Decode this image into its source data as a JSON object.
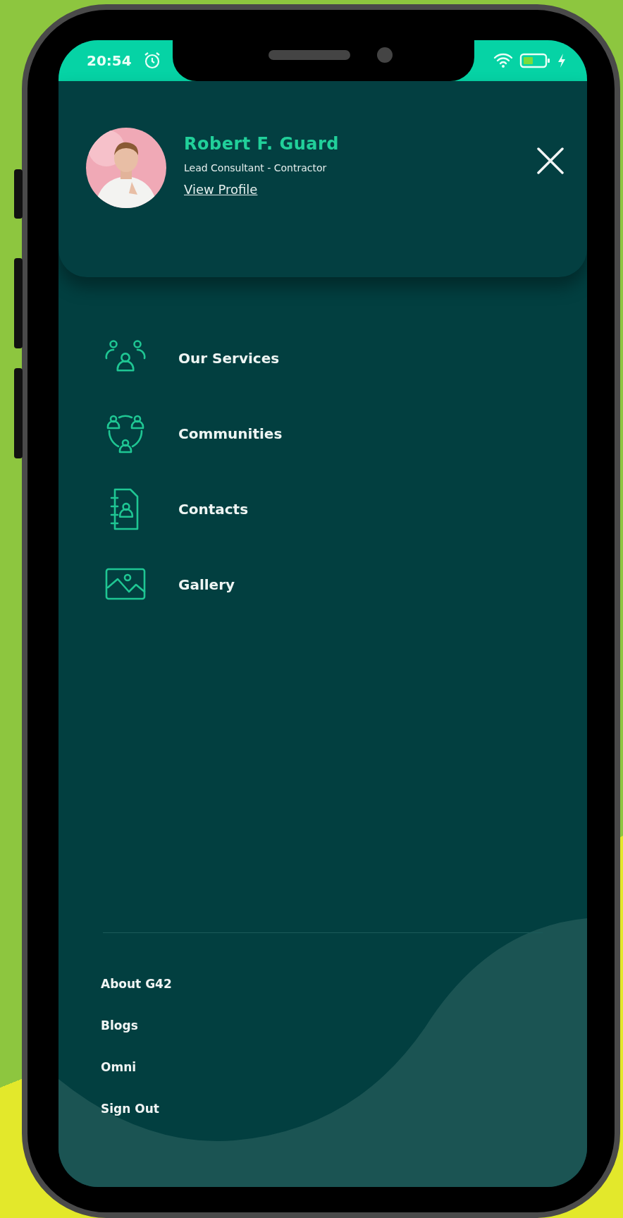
{
  "status_bar": {
    "time": "20:54"
  },
  "profile": {
    "name": "Robert F. Guard",
    "role": "Lead Consultant - Contractor",
    "link": "View Profile"
  },
  "menu": [
    {
      "label": "Our Services",
      "kind": "group"
    },
    {
      "label": "Communities",
      "kind": "network"
    },
    {
      "label": "Contacts",
      "kind": "contacts"
    },
    {
      "label": "Gallery",
      "kind": "gallery"
    }
  ],
  "footer_links": [
    "About G42",
    "Blogs",
    "Omni",
    "Sign Out"
  ]
}
